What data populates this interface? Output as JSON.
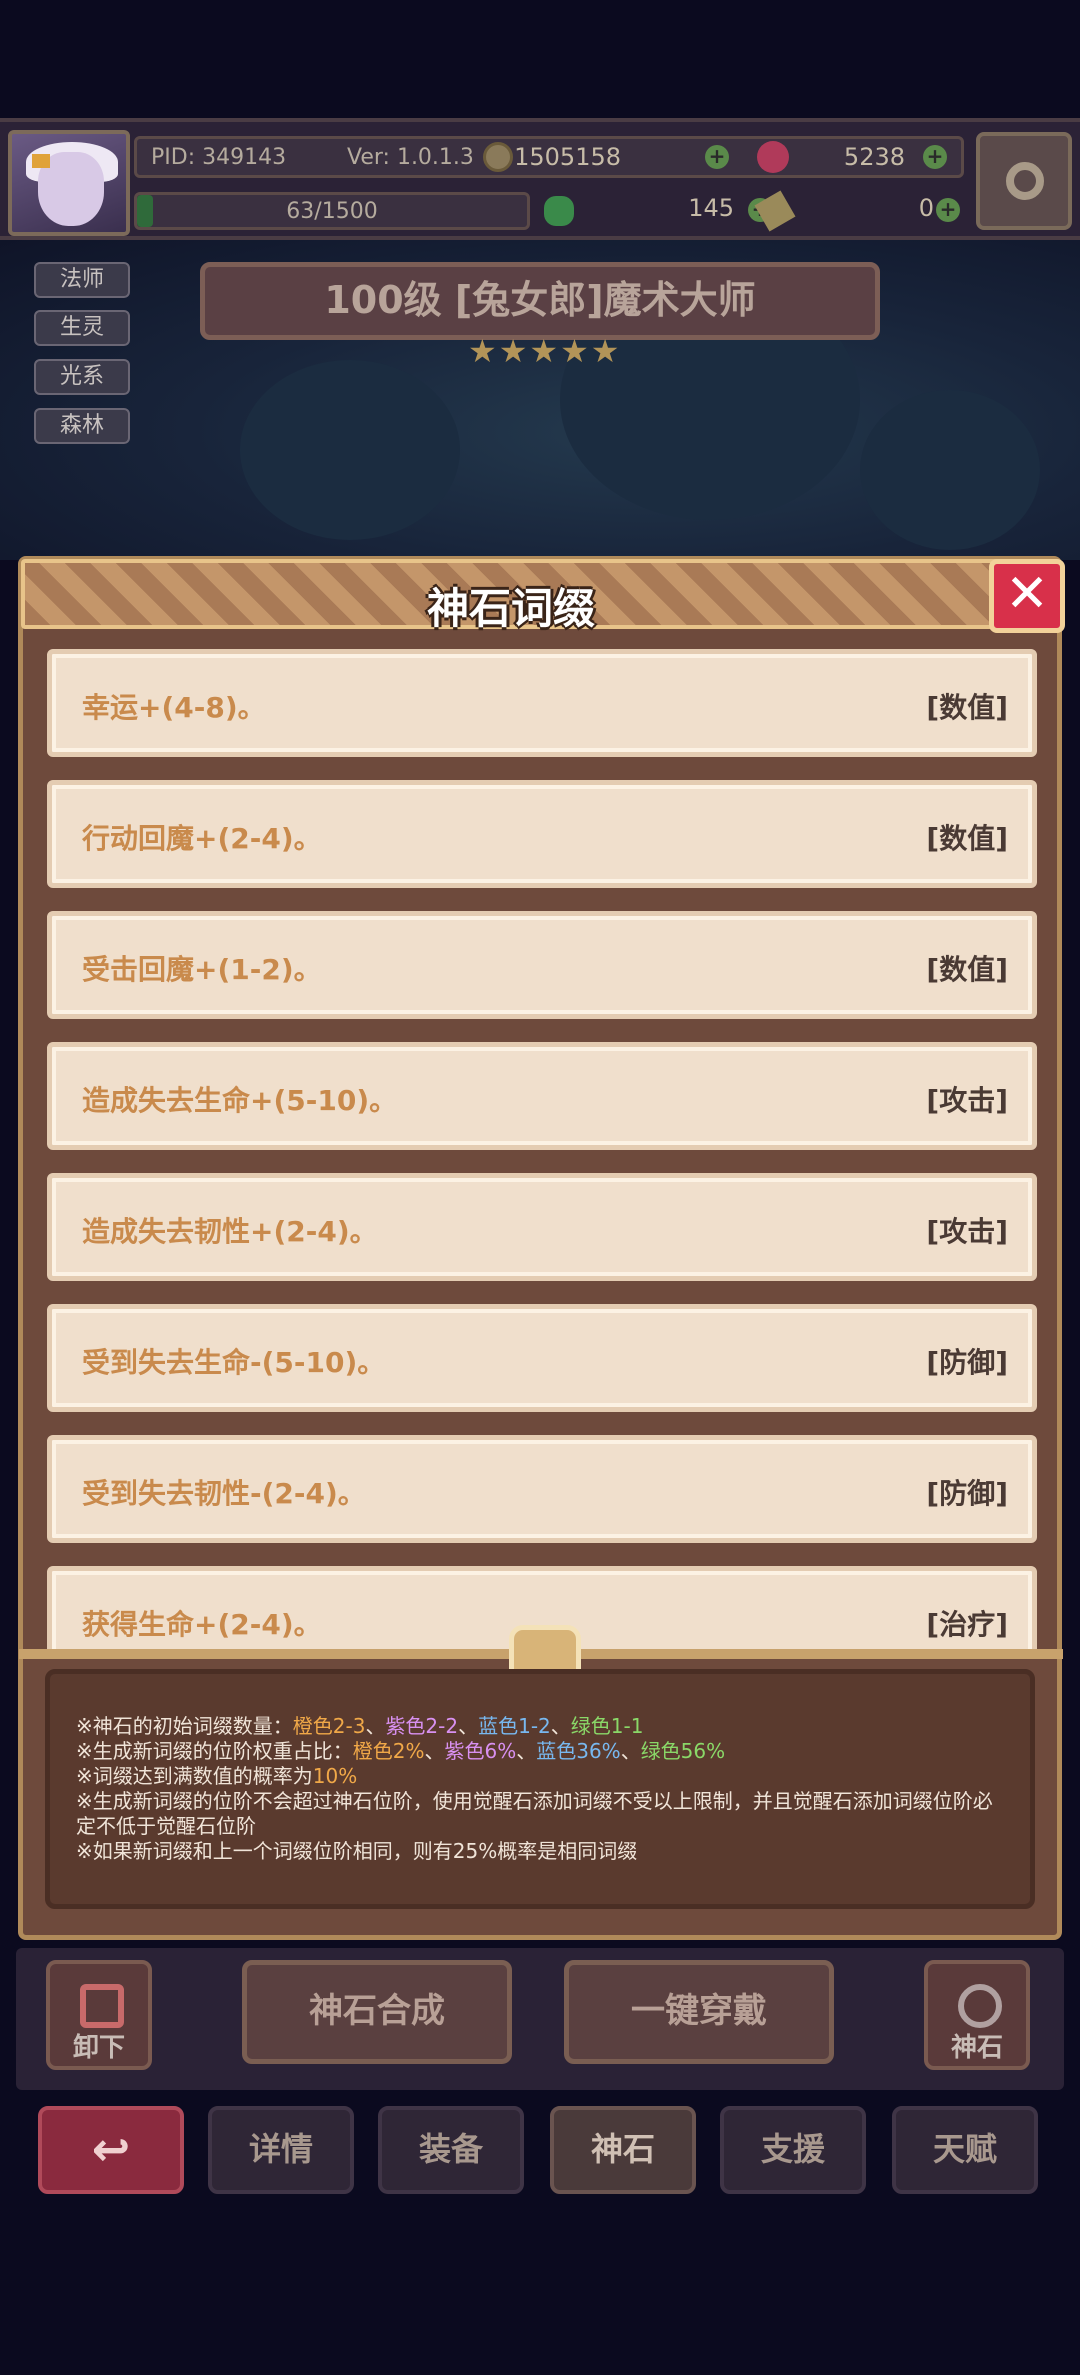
{
  "topbar": {
    "pid": "PID: 349143",
    "version": "Ver: 1.0.1.3",
    "gold": "1505158",
    "gems": "5238",
    "exp": "63/1500",
    "exp_fraction": 0.042,
    "clover": "145",
    "ticket": "0"
  },
  "hero": {
    "tags": [
      "法师",
      "生灵",
      "光系",
      "森林"
    ],
    "title": "100级 [兔女郎]魔术大师",
    "stars": "★★★★★"
  },
  "modal": {
    "title": "神石词缀",
    "close_label": "✕",
    "affixes": [
      {
        "name": "幸运+(4-8)。",
        "kind": "[数值]"
      },
      {
        "name": "行动回魔+(2-4)。",
        "kind": "[数值]"
      },
      {
        "name": "受击回魔+(1-2)。",
        "kind": "[数值]"
      },
      {
        "name": "造成失去生命+(5-10)。",
        "kind": "[攻击]"
      },
      {
        "name": "造成失去韧性+(2-4)。",
        "kind": "[攻击]"
      },
      {
        "name": "受到失去生命-(5-10)。",
        "kind": "[防御]"
      },
      {
        "name": "受到失去韧性-(2-4)。",
        "kind": "[防御]"
      },
      {
        "name": "获得生命+(2-4)。",
        "kind": "[治疗]"
      }
    ],
    "notes": {
      "l1_prefix": "※神石的初始词缀数量：",
      "l1_orange": "橙色2-3",
      "l1_purple": "紫色2-2",
      "l1_blue": "蓝色1-2",
      "l1_green": "绿色1-1",
      "sep": "、",
      "l2_prefix": "※生成新词缀的位阶权重占比：",
      "l2_orange": "橙色2%",
      "l2_purple": "紫色6%",
      "l2_blue": "蓝色36%",
      "l2_green": "绿色56%",
      "l3_prefix": "※词缀达到满数值的概率为",
      "l3_value": "10%",
      "l4": "※生成新词缀的位阶不会超过神石位阶，使用觉醒石添加词缀不受以上限制，并且觉醒石添加词缀位阶必定不低于觉醒石位阶",
      "l5": "※如果新词缀和上一个词缀位阶相同，则有25%概率是相同词缀"
    }
  },
  "actions": {
    "unload": "卸下",
    "compose": "神石合成",
    "equip_all": "一键穿戴",
    "godstone": "神石"
  },
  "nav": {
    "back": "↩",
    "items": [
      "详情",
      "装备",
      "神石",
      "支援",
      "天赋"
    ],
    "active_index": 2
  }
}
